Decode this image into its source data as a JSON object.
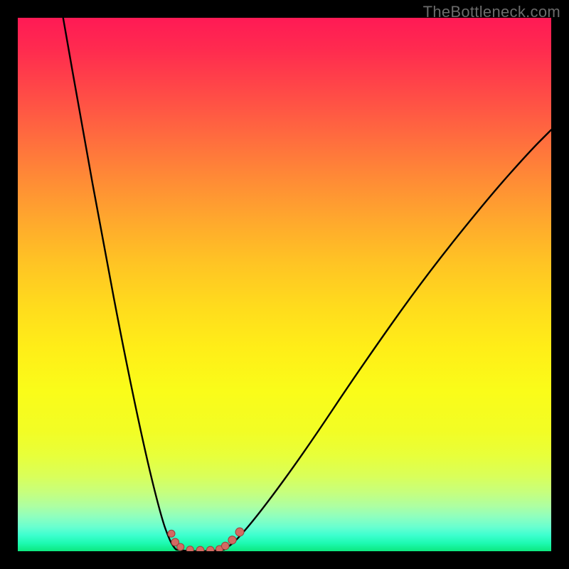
{
  "watermark": "TheBottleneck.com",
  "colors": {
    "background": "#000000",
    "gradient_top": "#ff1a55",
    "gradient_bottom": "#0de87f",
    "curve": "#000000",
    "marker_fill": "#d36a62",
    "marker_stroke": "#9a4640"
  },
  "chart_data": {
    "type": "line",
    "title": "",
    "xlabel": "",
    "ylabel": "",
    "xlim": [
      0,
      100
    ],
    "ylim": [
      0,
      100
    ],
    "grid": false,
    "legend": false,
    "note": "No axis ticks or labels are rendered; x/y values are estimated on an abstract 0–100 scale where bottom-of-plot = 0 and top-of-plot = 100.",
    "series": [
      {
        "name": "left-branch",
        "x": [
          8.5,
          12,
          16,
          20,
          24,
          27,
          28.5,
          29.3,
          29.7
        ],
        "y": [
          100,
          80,
          58,
          37,
          18,
          6,
          2,
          0.7,
          0.3
        ]
      },
      {
        "name": "valley-floor",
        "x": [
          29.7,
          31,
          33,
          35,
          37,
          38.7
        ],
        "y": [
          0.3,
          0.1,
          0,
          0,
          0.1,
          0.3
        ]
      },
      {
        "name": "right-branch",
        "x": [
          38.7,
          41,
          46,
          54,
          64,
          76,
          88,
          96,
          100
        ],
        "y": [
          0.3,
          2,
          8,
          19,
          34,
          51,
          66,
          75,
          79
        ]
      }
    ],
    "markers": {
      "name": "salmon-dots",
      "x": [
        28.8,
        29.5,
        30.5,
        32.3,
        34.2,
        36.1,
        37.8,
        38.9,
        40.2,
        41.6
      ],
      "y": [
        3.3,
        1.7,
        0.8,
        0.3,
        0.2,
        0.2,
        0.4,
        1.0,
        2.1,
        3.6
      ],
      "r": [
        5.0,
        5.3,
        5.0,
        5.0,
        5.3,
        5.3,
        5.0,
        5.3,
        5.6,
        5.9
      ]
    }
  }
}
